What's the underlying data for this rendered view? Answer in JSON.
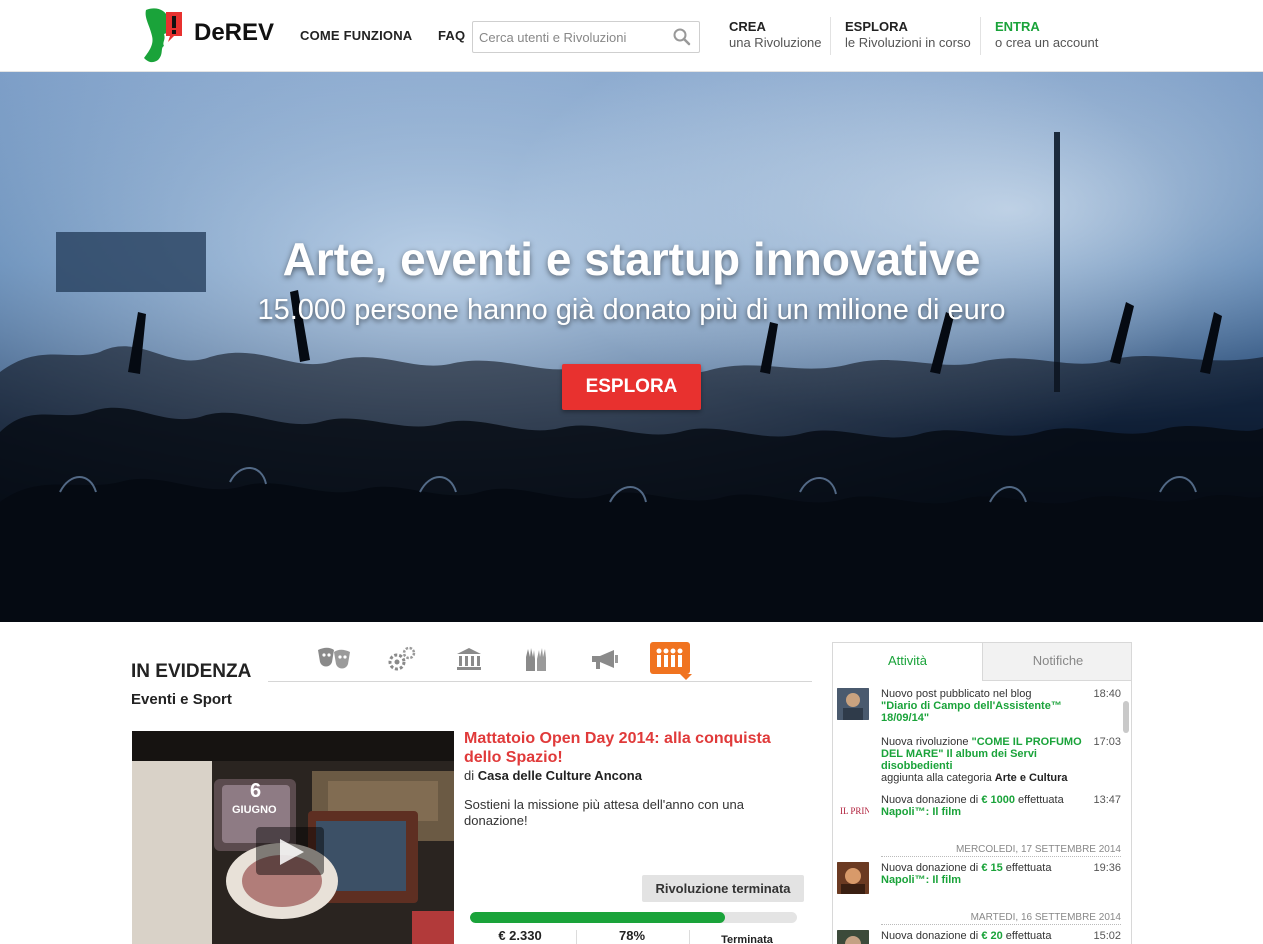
{
  "header": {
    "logo_text": "DeREV",
    "nav_come": "COME FUNZIONA",
    "nav_faq": "FAQ",
    "search_placeholder": "Cerca utenti e Rivoluzioni",
    "crea_title": "CREA",
    "crea_sub": "una Rivoluzione",
    "esplora_title": "ESPLORA",
    "esplora_sub": "le Rivoluzioni in corso",
    "entra_title": "ENTRA",
    "entra_sub": "o crea un account",
    "colors": {
      "green": "#1aa33a",
      "red": "#e8312f"
    }
  },
  "hero": {
    "title": "Arte, eventi e startup innovative",
    "subtitle": "15.000 persone hanno già donato più di un milione di euro",
    "button": "ESPLORA"
  },
  "featured": {
    "title": "IN EVIDENZA",
    "category": "Eventi e Sport",
    "category_icons": [
      "theater-masks-icon",
      "gears-icon",
      "museum-icon",
      "raised-hands-icon",
      "megaphone-icon",
      "people-group-icon"
    ],
    "active_category_icon": "people-group-icon",
    "video_overlay_date": "6",
    "video_overlay_month": "GIUGNO",
    "project_title": "Mattatoio Open Day 2014: alla conquista dello Spazio!",
    "project_by_prefix": "di",
    "project_author": "Casa delle Culture Ancona",
    "project_desc": "Sostieni la missione più attesa dell'anno con una donazione!",
    "status": "Rivoluzione terminata",
    "progress_percent": 78,
    "raised": "€ 2.330",
    "percent_label": "78%",
    "time_label": "Terminata"
  },
  "panel": {
    "tab_active": "Attività",
    "tab_inactive": "Notifiche",
    "items": [
      {
        "pre": "Nuovo post pubblicato nel blog",
        "link": "\"Diario di Campo dell'Assistente™ 18/09/14\"",
        "time": "18:40"
      },
      {
        "pre": "Nuova rivoluzione",
        "link": "\"COME IL PROFUMO DEL MARE\" Il album dei Servi disobbedienti",
        "post": "aggiunta alla categoria",
        "cat": "Arte e Cultura",
        "time": "17:03"
      },
      {
        "pre": "Nuova donazione di",
        "amount": "€ 1000",
        "mid": "effettuata",
        "target": "Napoli™: Il film",
        "time": "13:47"
      },
      {
        "pre": "Nuova donazione di",
        "amount": "€ 15",
        "mid": "effettuata",
        "target": "Napoli™: Il film",
        "time": "19:36"
      },
      {
        "pre": "Nuova donazione di",
        "amount": "€ 20",
        "mid": "effettuata",
        "time": "15:02"
      }
    ],
    "date1": "MERCOLEDI, 17 SETTEMBRE 2014",
    "date2": "MARTEDI, 16 SETTEMBRE 2014"
  }
}
